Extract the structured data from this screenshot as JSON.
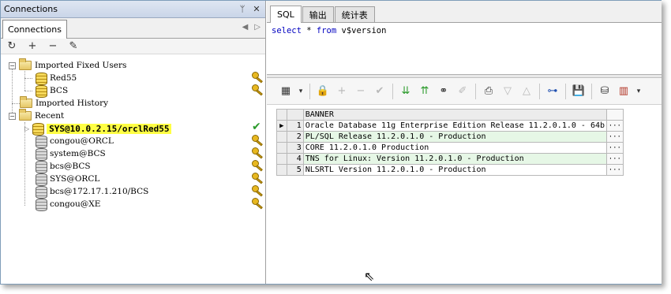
{
  "left_panel": {
    "title": "Connections",
    "pin_glyph": "ᛘ",
    "close_glyph": "✕",
    "tab_label": "Connections",
    "toolbar_icons": [
      "refresh-icon",
      "add-icon",
      "remove-icon",
      "properties-icon"
    ],
    "tree": {
      "groups": [
        {
          "label": "Imported Fixed Users",
          "expanded": true,
          "children": [
            {
              "label": "Red55",
              "icon": "gold-db-icon",
              "key": true
            },
            {
              "label": "BCS",
              "icon": "gold-db-icon",
              "key": true
            }
          ]
        },
        {
          "label": "Imported History",
          "expanded": false,
          "children": []
        },
        {
          "label": "Recent",
          "expanded": true,
          "children": [
            {
              "label": "SYS@10.0.2.15/orclRed55",
              "icon": "gold-db-icon",
              "selected": true,
              "connected": true
            },
            {
              "label": "congou@ORCL",
              "icon": "gray-db-icon",
              "key": true
            },
            {
              "label": "system@BCS",
              "icon": "gray-db-icon",
              "key": true
            },
            {
              "label": "bcs@BCS",
              "icon": "gray-db-icon",
              "key": true
            },
            {
              "label": "SYS@ORCL",
              "icon": "gray-db-icon",
              "key": true
            },
            {
              "label": "bcs@172.17.1.210/BCS",
              "icon": "gray-db-icon",
              "key": true
            },
            {
              "label": "congou@XE",
              "icon": "gray-db-icon",
              "key": true
            }
          ]
        }
      ]
    }
  },
  "right_panel": {
    "tabs": [
      {
        "label": "SQL",
        "active": true
      },
      {
        "label": "输出",
        "active": false
      },
      {
        "label": "统计表",
        "active": false
      }
    ],
    "editor": {
      "kw_select": "select",
      "star": " * ",
      "kw_from": "from",
      "object": " v$version"
    },
    "toolbar_icons": [
      "grid-icon",
      "lock-icon",
      "add-row-icon",
      "delete-row-icon",
      "post-icon",
      "first-record-icon",
      "last-record-icon",
      "binoculars-icon",
      "clear-icon",
      "print-icon",
      "down-icon",
      "up-icon",
      "tree-icon",
      "save-icon",
      "export-icon",
      "chart-icon"
    ],
    "grid": {
      "header": "BANNER",
      "rows": [
        {
          "num": "1",
          "value": "Oracle Database 11g Enterprise Edition Release 11.2.0.1.0 - 64b",
          "current": true
        },
        {
          "num": "2",
          "value": "PL/SQL Release 11.2.0.1.0 - Production"
        },
        {
          "num": "3",
          "value": "CORE\t11.2.0.1.0\tProduction"
        },
        {
          "num": "4",
          "value": "TNS for Linux: Version 11.2.0.1.0 - Production"
        },
        {
          "num": "5",
          "value": "NLSRTL Version 11.2.0.1.0 - Production"
        }
      ],
      "more_glyph": "···"
    }
  },
  "colors": {
    "selected_highlight": "#ffff44",
    "keyword": "#0000c0",
    "alt_row": "#e6f7e6"
  }
}
